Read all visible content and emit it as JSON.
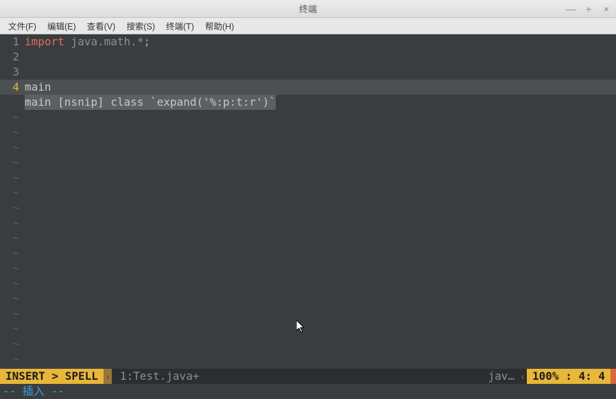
{
  "window": {
    "title": "终端",
    "controls": {
      "minimize": "—",
      "maximize": "+",
      "close": "×"
    }
  },
  "menubar": {
    "file": "文件(F)",
    "edit": "编辑(E)",
    "view": "查看(V)",
    "search": "搜索(S)",
    "terminal": "终端(T)",
    "help": "帮助(H)"
  },
  "editor": {
    "lines": {
      "1": {
        "num": "1",
        "import": "import",
        "pkg": " java.math.*",
        "semi": ";"
      },
      "2": {
        "num": "2"
      },
      "3": {
        "num": "3"
      },
      "4": {
        "num": "4",
        "text": "main"
      }
    },
    "completion": "main [nsnip] class `expand('%:p:t:r')`",
    "tilde": "~"
  },
  "statusbar": {
    "mode": " INSERT > SPELL ",
    "arrow": "›",
    "file": "1:Test.java+",
    "filetype": "jav…",
    "arrow2": "‹",
    "position": "100% :   4:  4"
  },
  "cmdline": "-- 插入 --"
}
